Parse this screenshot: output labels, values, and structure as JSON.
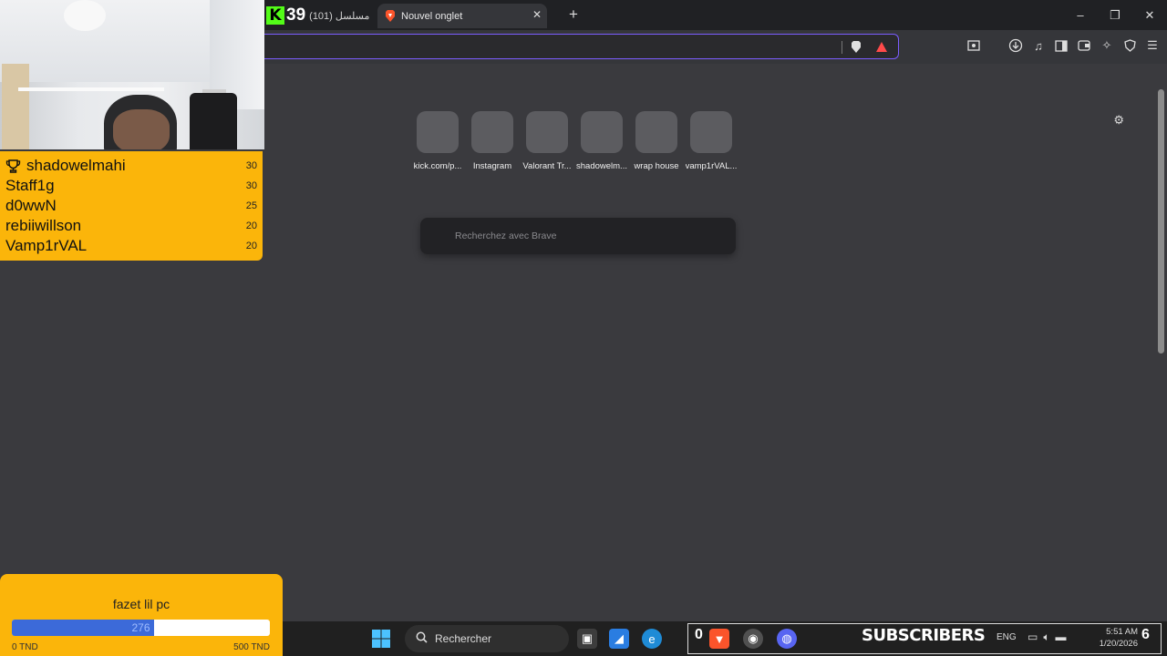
{
  "tabs": {
    "kick_count": "39",
    "inactive_title": "مسلسل (101)",
    "active_title": "Nouvel onglet",
    "close_glyph": "✕",
    "new_tab_glyph": "+"
  },
  "window_controls": {
    "minimize": "–",
    "maximize": "❐",
    "close": "✕"
  },
  "new_tab_page": {
    "tiles": [
      {
        "label": "kick.com/p..."
      },
      {
        "label": "Instagram"
      },
      {
        "label": "Valorant Tr..."
      },
      {
        "label": "shadowelm..."
      },
      {
        "label": "wrap house"
      },
      {
        "label": "vamp1rVAL..."
      }
    ],
    "search_placeholder": "Recherchez avec Brave",
    "settings_glyph": "⚙"
  },
  "leaderboard": {
    "entries": [
      {
        "name": "shadowelmahi",
        "score": "30"
      },
      {
        "name": "Staff1g",
        "score": "30"
      },
      {
        "name": "d0wwN",
        "score": "25"
      },
      {
        "name": "rebiiwillson",
        "score": "20"
      },
      {
        "name": "Vamp1rVAL",
        "score": "20"
      }
    ]
  },
  "donation_goal": {
    "title": "fazet lil pc",
    "current": "276",
    "progress_fraction": 0.552,
    "min_label": "0 TND",
    "max_label": "500 TND"
  },
  "taskbar": {
    "search_label": "Rechercher",
    "subscribers_label": "SUBSCRIBERS",
    "left_count": "0",
    "right_count": "6",
    "lang": "ENG",
    "time": "5:51 AM",
    "date": "1/20/2026"
  },
  "colors": {
    "overlay_yellow": "#fbb50a",
    "kick_green": "#53fc18",
    "omnibox_border": "#7b5cff",
    "goal_fill": "#3c6ad9"
  }
}
